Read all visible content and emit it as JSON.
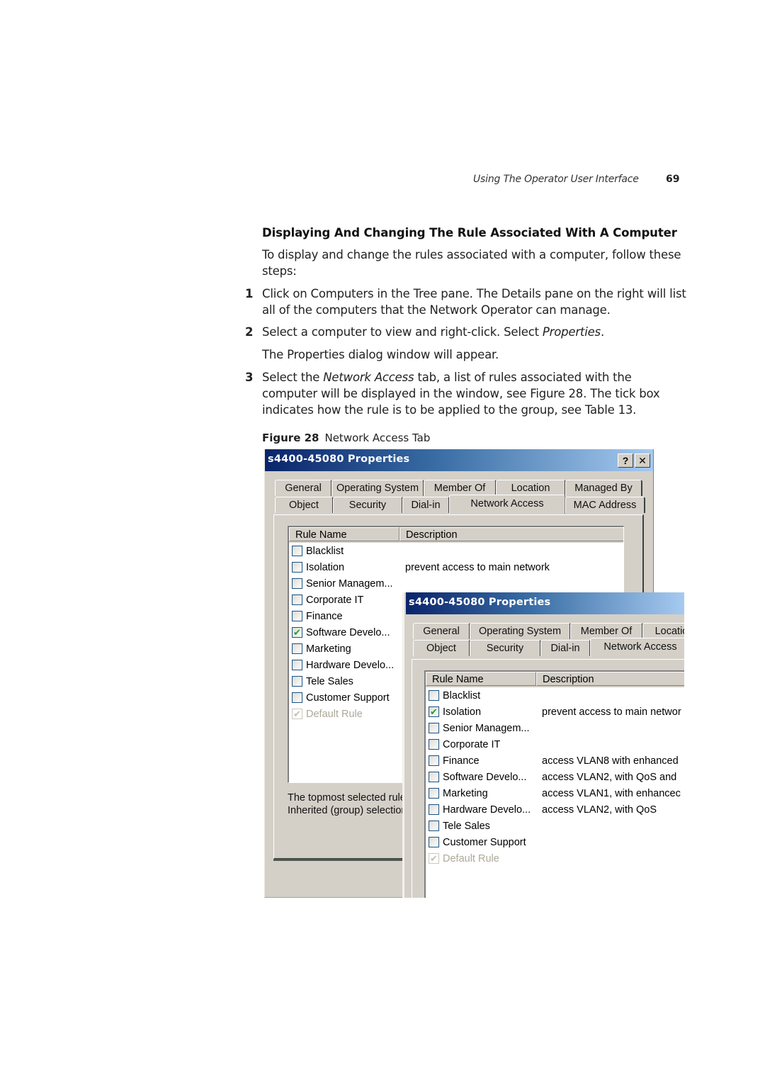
{
  "header": {
    "running_title": "Using The Operator User Interface",
    "page_number": "69"
  },
  "section": {
    "title": "Displaying And Changing The Rule Associated With A Computer",
    "intro": "To display and change the rules associated with a computer, follow these steps:"
  },
  "steps": [
    {
      "number": "1",
      "text": "Click on Computers in the Tree pane. The Details pane on the right will list all of the computers that the Network Operator can manage."
    },
    {
      "number": "2",
      "text_before": "Select a computer to view and right-click. Select ",
      "text_italic": "Properties",
      "text_after": ".",
      "followup": "The Properties dialog window will appear."
    },
    {
      "number": "3",
      "text_before": "Select the ",
      "text_italic": "Network Access",
      "text_after": " tab, a list of rules associated with the computer will be displayed in the window, see Figure 28. The tick box indicates how the rule is to be applied to the group, see Table 13."
    }
  ],
  "figure": {
    "label": "Figure 28",
    "caption": "Network Access Tab"
  },
  "dialog_back": {
    "title": "s4400-45080 Properties",
    "help_glyph": "?",
    "close_glyph": "✕",
    "tabs_row1": [
      "General",
      "Operating System",
      "Member Of",
      "Location",
      "Managed By"
    ],
    "tabs_row2": [
      "Object",
      "Security",
      "Dial-in",
      "Network Access",
      "MAC Address"
    ],
    "active_tab": "Network Access",
    "columns": [
      "Rule Name",
      "Description"
    ],
    "rules": [
      {
        "name": "Blacklist",
        "description": "",
        "checked": false,
        "disabled": false
      },
      {
        "name": "Isolation",
        "description": "prevent access to main network",
        "checked": false,
        "disabled": false
      },
      {
        "name": "Senior Managem...",
        "description": "",
        "checked": false,
        "disabled": false
      },
      {
        "name": "Corporate IT",
        "description": "",
        "checked": false,
        "disabled": false
      },
      {
        "name": "Finance",
        "description": "",
        "checked": false,
        "disabled": false
      },
      {
        "name": "Software Develo...",
        "description": "",
        "checked": true,
        "disabled": false
      },
      {
        "name": "Marketing",
        "description": "",
        "checked": false,
        "disabled": false
      },
      {
        "name": "Hardware Develo...",
        "description": "",
        "checked": false,
        "disabled": false
      },
      {
        "name": "Tele Sales",
        "description": "",
        "checked": false,
        "disabled": false
      },
      {
        "name": "Customer Support",
        "description": "",
        "checked": false,
        "disabled": false
      },
      {
        "name": "Default Rule",
        "description": "",
        "checked": true,
        "disabled": true
      }
    ],
    "note_line1": "The topmost selected rule",
    "note_line2": "Inherited (group) selection"
  },
  "dialog_front": {
    "title": "s4400-45080 Properties",
    "tabs_row1": [
      "General",
      "Operating System",
      "Member Of",
      "Locatio"
    ],
    "tabs_row2": [
      "Object",
      "Security",
      "Dial-in",
      "Network Access"
    ],
    "active_tab": "Network Access",
    "columns": [
      "Rule Name",
      "Description"
    ],
    "rules": [
      {
        "name": "Blacklist",
        "description": "",
        "checked": false,
        "disabled": false
      },
      {
        "name": "Isolation",
        "description": "prevent access to main networ",
        "checked": true,
        "disabled": false
      },
      {
        "name": "Senior Managem...",
        "description": "",
        "checked": false,
        "disabled": false
      },
      {
        "name": "Corporate IT",
        "description": "",
        "checked": false,
        "disabled": false
      },
      {
        "name": "Finance",
        "description": "access VLAN8 with enhanced",
        "checked": false,
        "disabled": false
      },
      {
        "name": "Software Develo...",
        "description": "access VLAN2, with QoS and",
        "checked": false,
        "disabled": false
      },
      {
        "name": "Marketing",
        "description": "access VLAN1, with enhancec",
        "checked": false,
        "disabled": false
      },
      {
        "name": "Hardware Develo...",
        "description": "access VLAN2, with QoS",
        "checked": false,
        "disabled": false
      },
      {
        "name": "Tele Sales",
        "description": "",
        "checked": false,
        "disabled": false
      },
      {
        "name": "Customer Support",
        "description": "",
        "checked": false,
        "disabled": false
      },
      {
        "name": "Default Rule",
        "description": "",
        "checked": true,
        "disabled": true
      }
    ]
  },
  "colors": {
    "titlebar_start": "#0a246a",
    "titlebar_end": "#a6caf0",
    "dialog_face": "#d4d0c8",
    "check_green": "#21a121"
  }
}
